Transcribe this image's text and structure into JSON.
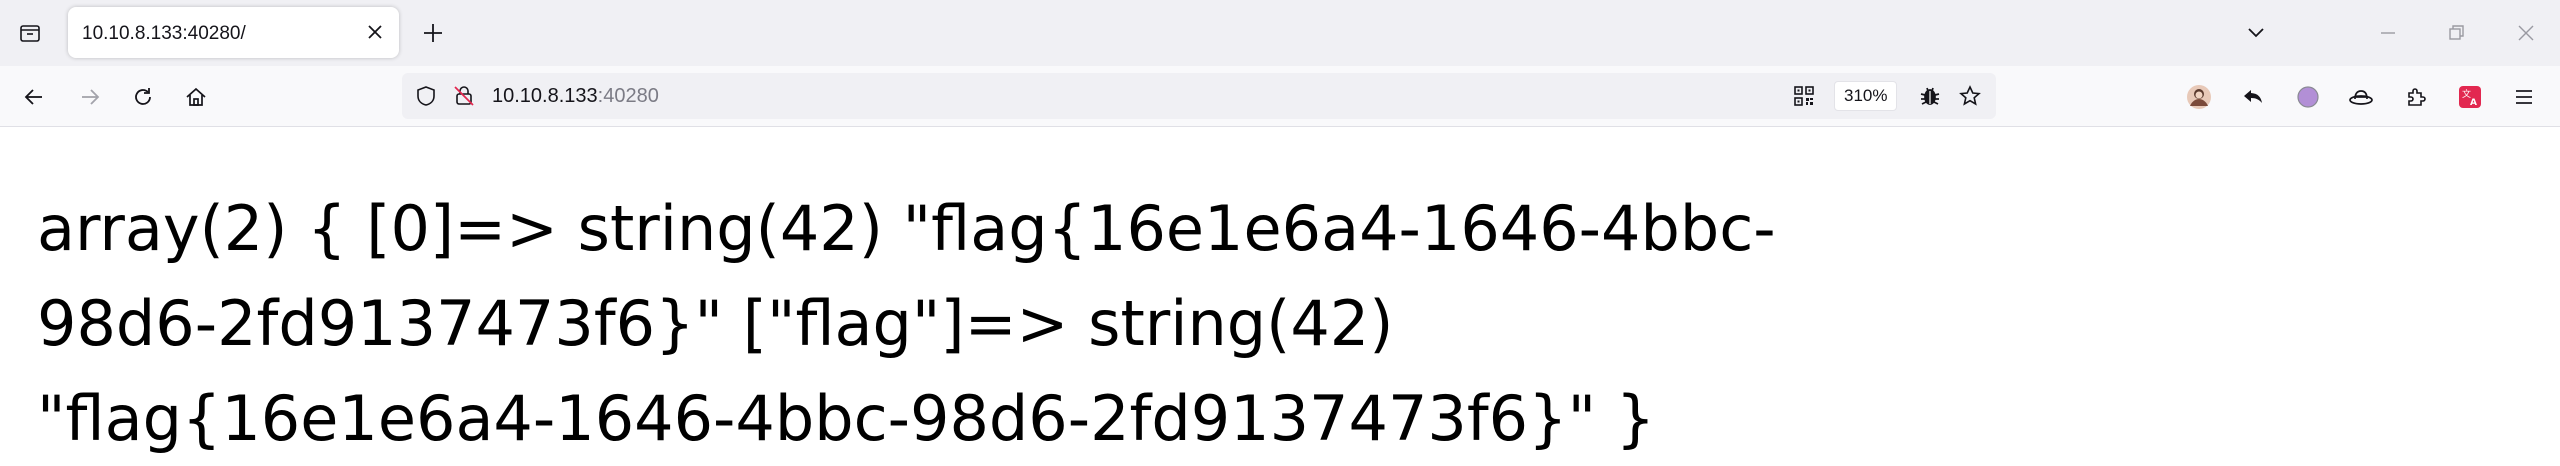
{
  "browser": {
    "tab": {
      "title": "10.10.8.133:40280/"
    },
    "address_bar": {
      "host": "10.10.8.133",
      "port": ":40280",
      "zoom": "310%"
    },
    "icons": {
      "tab_list": "tab-list-icon",
      "close": "close-icon",
      "new_tab": "plus-icon",
      "list_all_tabs": "chevron-down-icon",
      "back": "arrow-left-icon",
      "forward": "arrow-right-icon",
      "reload": "reload-icon",
      "home": "home-icon",
      "tracking_protection": "shield-icon",
      "insecure": "lock-warning-icon",
      "qr": "qr-code-icon",
      "extension_bug": "bug-icon",
      "bookmark": "star-icon",
      "menu": "hamburger-icon"
    },
    "colors": {
      "tabstrip_bg": "#f0f0f4",
      "navbar_bg": "#f9f9fb",
      "translate_accent": "#e22850",
      "circle_ext": "#b28fd6"
    }
  },
  "page": {
    "line1": "array(2) { [0]=> string(42) \"flag{16e1e6a4-1646-4bbc-",
    "line2": "98d6-2fd9137473f6}\" [\"flag\"]=> string(42)",
    "line3": "\"flag{16e1e6a4-1646-4bbc-98d6-2fd9137473f6}\" }"
  }
}
